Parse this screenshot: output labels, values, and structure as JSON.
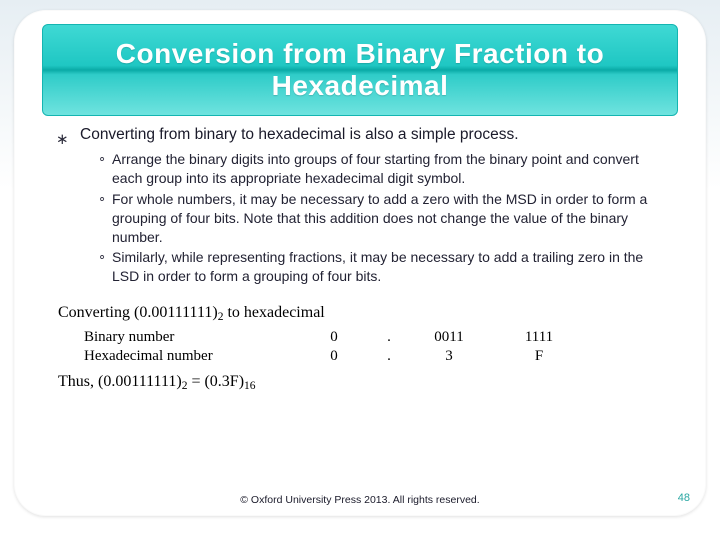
{
  "title": "Conversion from Binary Fraction to Hexadecimal",
  "lead_bullet_glyph": "∗",
  "lead": "Converting from binary to hexadecimal is also a simple process.",
  "subs": [
    "Arrange the binary digits into groups of four starting from the binary point and convert each group into its appropriate hexadecimal digit symbol.",
    "For whole numbers, it may be necessary to add a zero with the MSD in order to form a grouping of four bits. Note that this addition does not change the value of the binary number.",
    "Similarly, while representing fractions, it may be necessary to add a trailing zero in the LSD in order to form a grouping of four bits."
  ],
  "example": {
    "title_prefix": "Converting (0.00111111)",
    "title_sub": "2",
    "title_suffix": " to hexadecimal",
    "rows": [
      {
        "label": "Binary number",
        "c0": "0",
        "sep": ".",
        "c1": "0011",
        "c2": "1111"
      },
      {
        "label": "Hexadecimal number",
        "c0": "0",
        "sep": ".",
        "c1": "3",
        "c2": "F"
      }
    ],
    "conclusion_prefix": "Thus, (0.00111111)",
    "conclusion_sub1": "2",
    "conclusion_mid": " = (0.3F)",
    "conclusion_sub2": "16"
  },
  "footer": "© Oxford University Press 2013. All rights reserved.",
  "page_number": "48"
}
